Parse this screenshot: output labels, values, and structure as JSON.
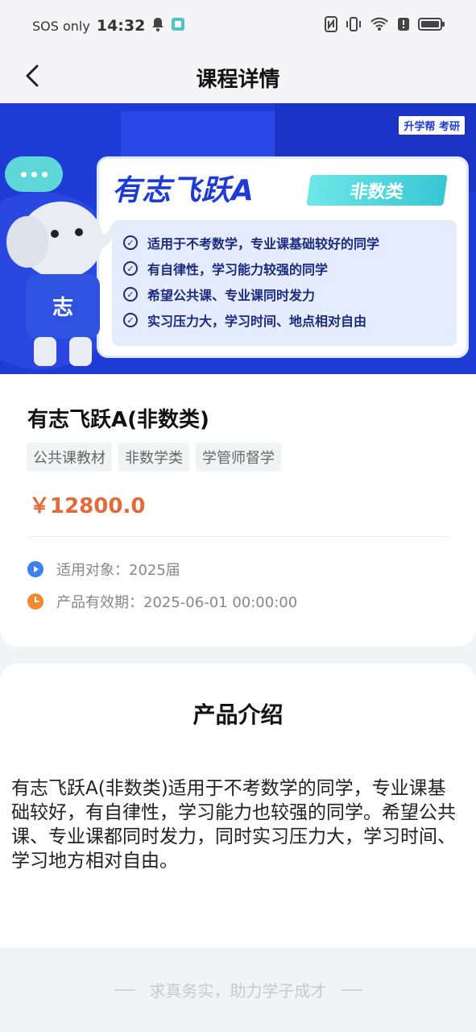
{
  "status_bar": {
    "carrier": "SOS only",
    "time": "14:32",
    "left_icons": [
      "bell-icon",
      "app-notification-icon"
    ],
    "right_icons": [
      "nfc-icon",
      "vibrate-icon",
      "wifi-icon",
      "alert-icon",
      "battery-icon"
    ]
  },
  "nav": {
    "title": "课程详情",
    "back_icon": "chevron-left-icon"
  },
  "banner": {
    "brand": "升学帮 考研",
    "title": "有志飞跃A",
    "tag": "非数类",
    "mascot_label": "志",
    "items": [
      "适用于不考数学，专业课基础较好的同学",
      "有自律性，学习能力较强的同学",
      "希望公共课、专业课同时发力",
      "实习压力大，学习时间、地点相对自由"
    ]
  },
  "product": {
    "title": "有志飞跃A(非数类)",
    "tags": [
      "公共课教材",
      "非数学类",
      "学管师督学"
    ],
    "price": "￥12800.0",
    "audience": "适用对象：2025届",
    "validity": "产品有效期：2025-06-01 00:00:00"
  },
  "intro": {
    "title": "产品介绍",
    "text": "有志飞跃A(非数类)适用于不考数学的同学，专业课基础较好，有自律性，学习能力也较强的同学。希望公共课、专业课都同时发力，同时实习压力大，学习时间、学习地方相对自由。"
  },
  "footer": {
    "slogan": "求真务实，助力学子成才"
  },
  "colors": {
    "banner_blue": "#1f3bd6",
    "price_orange": "#e06a3a",
    "audience_icon": "#3b7ff2",
    "validity_icon": "#f08a2e"
  }
}
